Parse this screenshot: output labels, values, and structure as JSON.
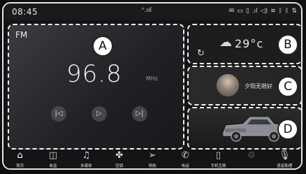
{
  "status_bar": {
    "time": "08:45",
    "center_signal": "ⁿ.ııl",
    "icons": [
      "message-icon",
      "mail-icon",
      "sd-card-icon",
      "signal-icon",
      "volume-icon",
      "wifi-icon",
      "bluetooth-icon",
      "bluetooth-alt-icon",
      "usb-icon"
    ]
  },
  "radio": {
    "band": "FM",
    "frequency": "96.8",
    "unit": "MHz",
    "callout": "A"
  },
  "weather": {
    "temperature": "29°c",
    "icon": "partly-cloudy-icon",
    "callout": "B"
  },
  "music": {
    "title": "夕阳无限好",
    "callout": "C"
  },
  "vehicle": {
    "callout": "D"
  },
  "nav": {
    "items": [
      {
        "label": "首页",
        "icon": "home-icon"
      },
      {
        "label": "收音",
        "icon": "radio-icon"
      },
      {
        "label": "多媒体",
        "icon": "music-icon"
      },
      {
        "label": "空调",
        "icon": "fan-icon"
      },
      {
        "label": "导航",
        "icon": "navigation-icon"
      },
      {
        "label": "电话",
        "icon": "phone-icon"
      },
      {
        "label": "手机互联",
        "icon": "phone-link-icon"
      },
      {
        "label": "",
        "icon": "settings-icon"
      },
      {
        "label": "语音助理",
        "icon": "microphone-icon"
      }
    ]
  }
}
